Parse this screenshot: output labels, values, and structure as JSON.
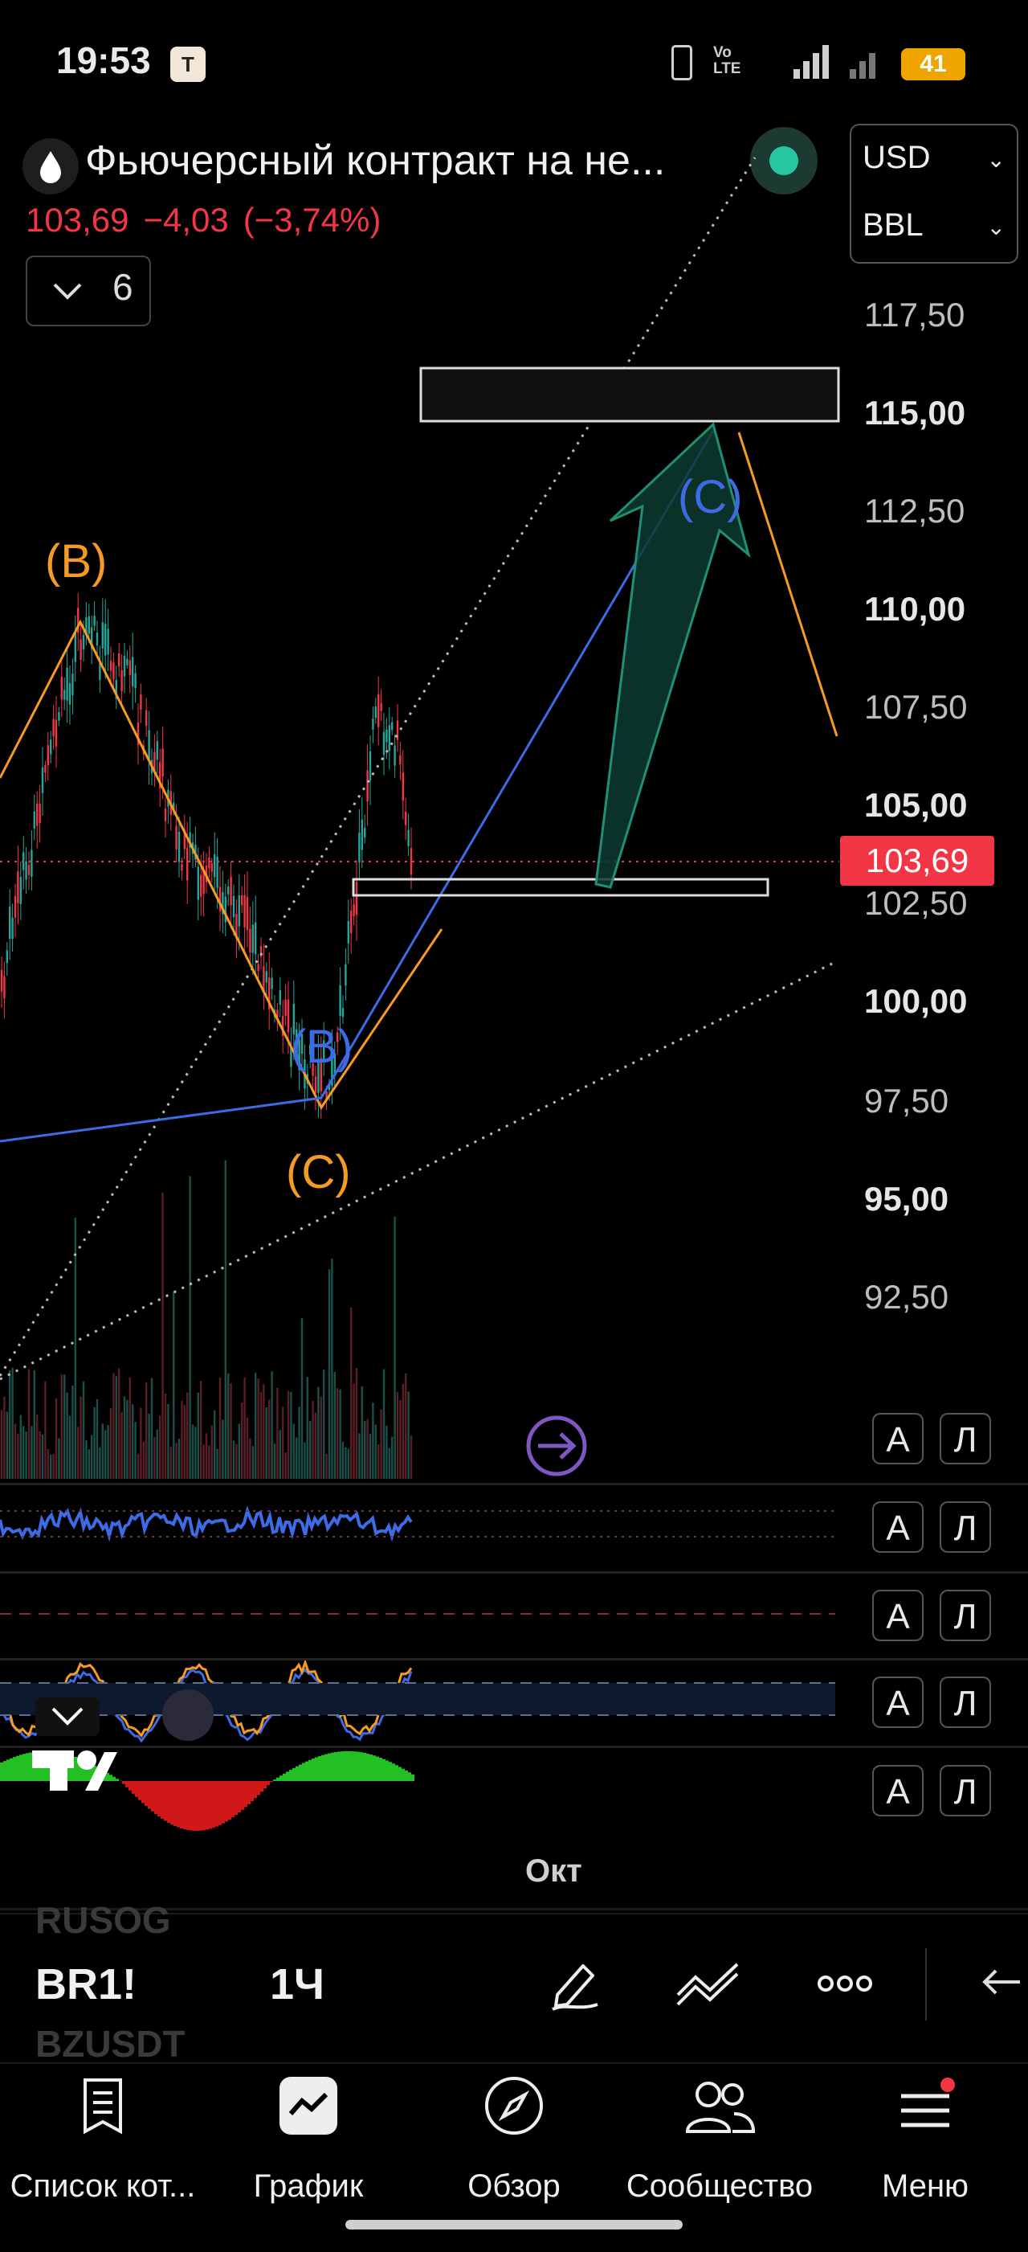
{
  "status_bar": {
    "time": "19:53",
    "app_badge": "T",
    "network": "Vo LTE",
    "battery": "41"
  },
  "header": {
    "title": "Фьючерсный контракт на не...",
    "price": "103,69",
    "change": "−4,03",
    "change_pct": "(−3,74%)",
    "selector_value": "6",
    "currency": "USD",
    "unit": "BBL"
  },
  "price_axis": {
    "ticks": [
      "117,50",
      "115,00",
      "112,50",
      "110,00",
      "107,50",
      "105,00",
      "102,50",
      "100,00",
      "97,50",
      "95,00",
      "92,50"
    ],
    "current_price": "103,69"
  },
  "chart_data": {
    "type": "line",
    "title": "",
    "ylim": [
      91,
      119
    ],
    "current_price": 103.69,
    "wave_labels": [
      {
        "text": "(B)",
        "price": 110.5,
        "color": "#f59a23"
      },
      {
        "text": "(C)",
        "price": 95.5,
        "color": "#f59a23"
      },
      {
        "text": "(B)",
        "price": 98.6,
        "color": "#3d6be6"
      },
      {
        "text": "(C)",
        "price": 112.5,
        "color": "#3d6be6"
      }
    ],
    "zones": [
      {
        "name": "target-zone",
        "from": 114.8,
        "to": 116.2
      },
      {
        "name": "support-zone",
        "from": 103.1,
        "to": 103.5
      }
    ]
  },
  "indicator_buttons": {
    "a_label": "А",
    "l_label": "Л"
  },
  "time_axis": {
    "month": "Окт"
  },
  "toolbar": {
    "ghost_top": "RUSOG",
    "symbol": "BR1!",
    "ghost_bottom": "BZUSDT",
    "interval": "1Ч"
  },
  "nav": [
    {
      "label": "Список кот...",
      "icon": "list-icon"
    },
    {
      "label": "График",
      "icon": "chart-icon"
    },
    {
      "label": "Обзор",
      "icon": "compass-icon"
    },
    {
      "label": "Сообщество",
      "icon": "community-icon"
    },
    {
      "label": "Меню",
      "icon": "menu-icon"
    }
  ],
  "colors": {
    "up": "#26a69a",
    "down": "#f23645",
    "orange": "#f59a23",
    "blue": "#3d6be6",
    "accent": "#26c6a0"
  }
}
